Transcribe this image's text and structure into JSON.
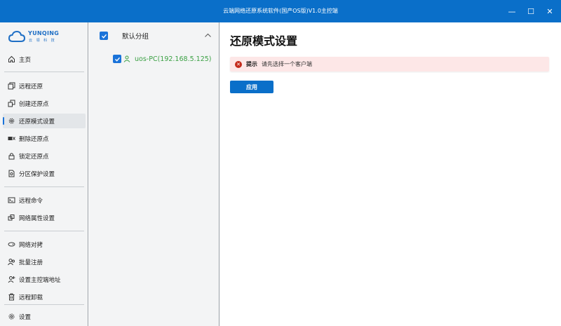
{
  "window": {
    "title": "云端网络还原系统软件(国产OS版)V1.0主控端",
    "controls": {
      "minimize": "—",
      "maximize": "☐",
      "close": "✕"
    }
  },
  "logo": {
    "brand": "YUNQING",
    "sub": "云 领 科 技"
  },
  "sidebar": {
    "items": [
      {
        "label": "主页",
        "icon": "home-icon"
      },
      {
        "label": "远程还原",
        "icon": "restore-copy-icon"
      },
      {
        "label": "创建还原点",
        "icon": "create-point-icon"
      },
      {
        "label": "还原模式设置",
        "icon": "gear-icon",
        "active": true
      },
      {
        "label": "删除还原点",
        "icon": "delete-point-icon"
      },
      {
        "label": "锁定还原点",
        "icon": "lock-icon"
      },
      {
        "label": "分区保护设置",
        "icon": "partition-icon"
      },
      {
        "label": "远程命令",
        "icon": "terminal-icon"
      },
      {
        "label": "网络属性设置",
        "icon": "network-icon"
      },
      {
        "label": "网络对拷",
        "icon": "disk-copy-icon"
      },
      {
        "label": "批量注册",
        "icon": "users-icon"
      },
      {
        "label": "设置主控端地址",
        "icon": "address-icon"
      },
      {
        "label": "远程卸载",
        "icon": "trash-icon"
      },
      {
        "label": "设置",
        "icon": "settings-icon"
      }
    ]
  },
  "tree": {
    "group": {
      "label": "默认分组",
      "checked": true,
      "expanded": true
    },
    "clients": [
      {
        "label": "uos-PC(192.168.5.125)",
        "checked": true
      }
    ]
  },
  "main": {
    "title": "还原模式设置",
    "alert": {
      "heading": "提示",
      "message": "请先选择一个客户端"
    },
    "apply_label": "应用"
  },
  "colors": {
    "accent": "#0a6fc9",
    "client_text": "#3aa043",
    "alert_bg": "#fde7e7",
    "alert_icon": "#c42b1c"
  }
}
